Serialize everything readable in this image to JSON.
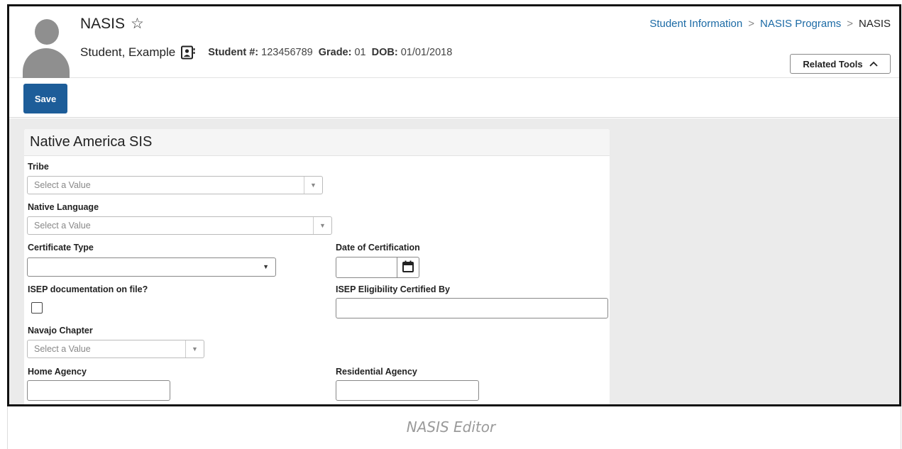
{
  "header": {
    "title": "NASIS",
    "student_name": "Student, Example",
    "student_num_label": "Student #:",
    "student_num": "123456789",
    "grade_label": "Grade:",
    "grade": "01",
    "dob_label": "DOB:",
    "dob": "01/01/2018"
  },
  "breadcrumb": {
    "items": [
      "Student Information",
      "NASIS Programs",
      "NASIS"
    ]
  },
  "related_tools": {
    "label": "Related Tools"
  },
  "toolbar": {
    "save_label": "Save"
  },
  "panel": {
    "title": "Native America SIS",
    "fields": {
      "tribe": {
        "label": "Tribe",
        "placeholder": "Select a Value"
      },
      "native_language": {
        "label": "Native Language",
        "placeholder": "Select a Value"
      },
      "certificate_type": {
        "label": "Certificate Type",
        "value": ""
      },
      "date_of_certification": {
        "label": "Date of Certification",
        "value": ""
      },
      "isep_documentation": {
        "label": "ISEP documentation on file?",
        "checked": false
      },
      "isep_certified_by": {
        "label": "ISEP Eligibility Certified By",
        "value": ""
      },
      "navajo_chapter": {
        "label": "Navajo Chapter",
        "placeholder": "Select a Value"
      },
      "home_agency": {
        "label": "Home Agency",
        "value": ""
      },
      "residential_agency": {
        "label": "Residential Agency",
        "value": ""
      }
    }
  },
  "caption": "NASIS Editor",
  "icons": {
    "favorite": "star-outline-icon",
    "contact": "contact-card-icon",
    "related_tools": "chevron-up-icon",
    "calendar": "calendar-icon",
    "dropdown": "caret-down-icon"
  },
  "colors": {
    "primary": "#1d5d99",
    "link": "#1b6aa5",
    "background": "#ebebeb"
  }
}
